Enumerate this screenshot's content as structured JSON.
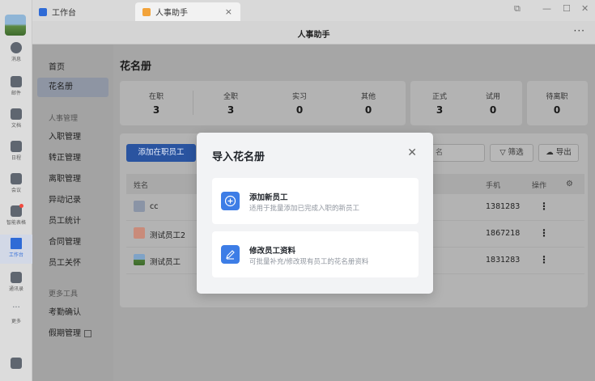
{
  "rail": {
    "items": [
      {
        "label": "消息",
        "icon": "message-icon"
      },
      {
        "label": "邮件",
        "icon": "mail-icon"
      },
      {
        "label": "文档",
        "icon": "doc-icon"
      },
      {
        "label": "日程",
        "icon": "calendar-icon"
      },
      {
        "label": "会议",
        "icon": "meeting-icon"
      },
      {
        "label": "智能表格",
        "icon": "smart-sheet-icon"
      },
      {
        "label": "工作台",
        "icon": "workbench-icon"
      },
      {
        "label": "通讯录",
        "icon": "contacts-icon"
      },
      {
        "label": "更多",
        "icon": "more-icon"
      }
    ]
  },
  "tabs": {
    "tab1": "工作台",
    "tab2": "人事助手",
    "close": "×"
  },
  "window_controls": {
    "pin": "⧉",
    "min": "—",
    "max": "☐",
    "close": "✕"
  },
  "titlebar": {
    "title": "人事助手",
    "more": "···"
  },
  "sidenav": {
    "home": "首页",
    "roster": "花名册",
    "section_hr": "人事管理",
    "onboarding": "入职管理",
    "regularization": "转正管理",
    "offboarding": "离职管理",
    "changes": "异动记录",
    "stats": "员工统计",
    "contracts": "合同管理",
    "care": "员工关怀",
    "section_tools": "更多工具",
    "attendance": "考勤确认",
    "leave": "假期管理"
  },
  "main": {
    "title": "花名册",
    "stats_a": [
      {
        "label": "在职",
        "value": "3"
      },
      {
        "label": "全职",
        "value": "3"
      },
      {
        "label": "实习",
        "value": "0"
      },
      {
        "label": "其他",
        "value": "0"
      }
    ],
    "stats_b": [
      {
        "label": "正式",
        "value": "3"
      },
      {
        "label": "试用",
        "value": "0"
      }
    ],
    "stats_c": {
      "label": "待离职",
      "value": "0"
    },
    "add_button": "添加在职员工",
    "search_placeholder": "名",
    "filter_button": "筛选",
    "export_button": "导出",
    "columns": {
      "name": "姓名",
      "phone": "手机",
      "action": "操作"
    },
    "rows": [
      {
        "name": "cc",
        "phone": "1381283"
      },
      {
        "name": "测试员工2",
        "phone": "1867218"
      },
      {
        "name": "测试员工",
        "phone": "1831283"
      }
    ]
  },
  "modal": {
    "title": "导入花名册",
    "close": "✕",
    "option1": {
      "title": "添加新员工",
      "desc": "适用于批量添加已完成入职的新员工"
    },
    "option2": {
      "title": "修改员工资料",
      "desc": "可批量补充/修改现有员工的花名册资料"
    }
  }
}
